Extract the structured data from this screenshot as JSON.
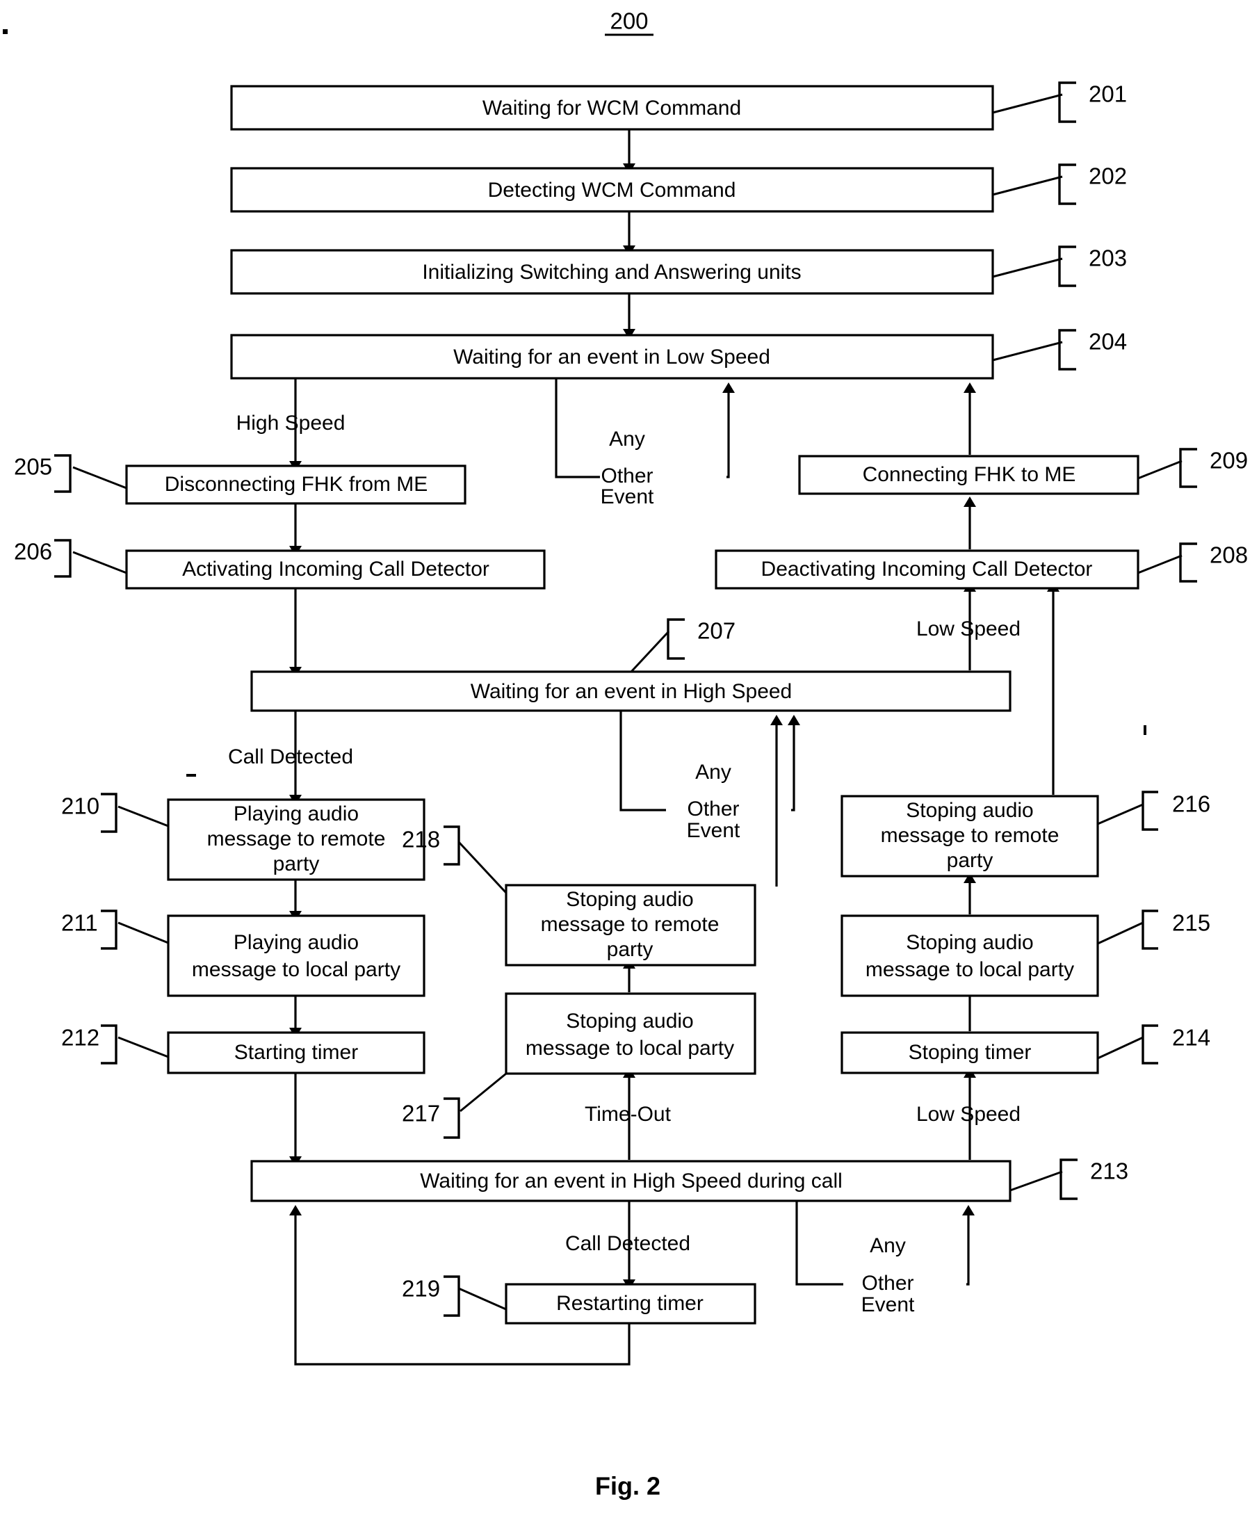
{
  "figure": {
    "number_top": "200",
    "caption": "Fig. 2"
  },
  "nodes": {
    "n201": {
      "ref": "201",
      "label": "Waiting for WCM Command"
    },
    "n202": {
      "ref": "202",
      "label": "Detecting WCM Command"
    },
    "n203": {
      "ref": "203",
      "label": "Initializing Switching and Answering units"
    },
    "n204": {
      "ref": "204",
      "label": "Waiting for an event in Low Speed"
    },
    "n205": {
      "ref": "205",
      "label": "Disconnecting FHK from ME"
    },
    "n206": {
      "ref": "206",
      "label": "Activating Incoming Call Detector"
    },
    "n207": {
      "ref": "207",
      "label": "Waiting for an event in High Speed"
    },
    "n208": {
      "ref": "208",
      "label": "Deactivating Incoming Call Detector"
    },
    "n209": {
      "ref": "209",
      "label": "Connecting FHK to ME"
    },
    "n210": {
      "ref": "210",
      "label_l1": "Playing audio",
      "label_l2": "message to remote",
      "label_l3": "party"
    },
    "n211": {
      "ref": "211",
      "label_l1": "Playing audio",
      "label_l2": "message to local party"
    },
    "n212": {
      "ref": "212",
      "label": "Starting timer"
    },
    "n213": {
      "ref": "213",
      "label": "Waiting for an event in High Speed during call"
    },
    "n214": {
      "ref": "214",
      "label": "Stoping timer"
    },
    "n215": {
      "ref": "215",
      "label_l1": "Stoping audio",
      "label_l2": "message to local party"
    },
    "n216": {
      "ref": "216",
      "label_l1": "Stoping audio",
      "label_l2": "message to remote",
      "label_l3": "party"
    },
    "n217": {
      "ref": "217",
      "label_l1": "Stoping audio",
      "label_l2": "message to local party"
    },
    "n218": {
      "ref": "218",
      "label_l1": "Stoping audio",
      "label_l2": "message to remote",
      "label_l3": "party"
    },
    "n219": {
      "ref": "219",
      "label": "Restarting timer"
    }
  },
  "edge_labels": {
    "high_speed": "High Speed",
    "any_other_1": "Any",
    "any_other_2": "Other",
    "any_other_3": "Event",
    "low_speed_mid": "Low Speed",
    "call_detected_top": "Call Detected",
    "any_other_hs_1": "Any",
    "any_other_hs_2": "Other",
    "any_other_hs_3": "Event",
    "time_out": "Time-Out",
    "low_speed_bottom": "Low Speed",
    "call_detected_bottom": "Call Detected",
    "any_other_call_1": "Any",
    "any_other_call_2": "Other",
    "any_other_call_3": "Event"
  },
  "colors": {
    "stroke": "#000000",
    "background": "#ffffff"
  }
}
